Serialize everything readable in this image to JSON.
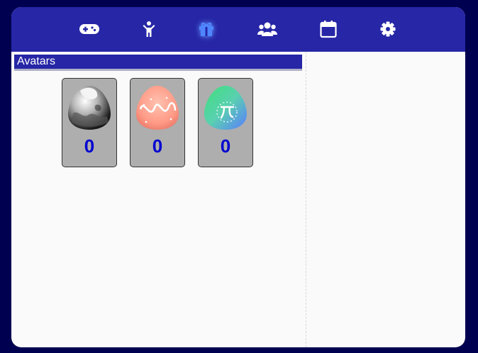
{
  "nav": {
    "tabs": [
      {
        "name": "gamepad-icon",
        "active": false
      },
      {
        "name": "person-icon",
        "active": false
      },
      {
        "name": "gift-icon",
        "active": true
      },
      {
        "name": "users-icon",
        "active": false
      },
      {
        "name": "calendar-icon",
        "active": false
      },
      {
        "name": "gear-icon",
        "active": false
      }
    ]
  },
  "avatars": {
    "title": "Avatars",
    "items": [
      {
        "name": "gray-egg-avatar",
        "count": "0"
      },
      {
        "name": "peach-swirl-egg-avatar",
        "count": "0"
      },
      {
        "name": "pi-egg-avatar",
        "count": "0"
      }
    ]
  },
  "colors": {
    "background": "#000050",
    "topbar": "#2626a6",
    "panel": "#fafafa",
    "card": "#aeaeae",
    "count": "#0000d0"
  }
}
